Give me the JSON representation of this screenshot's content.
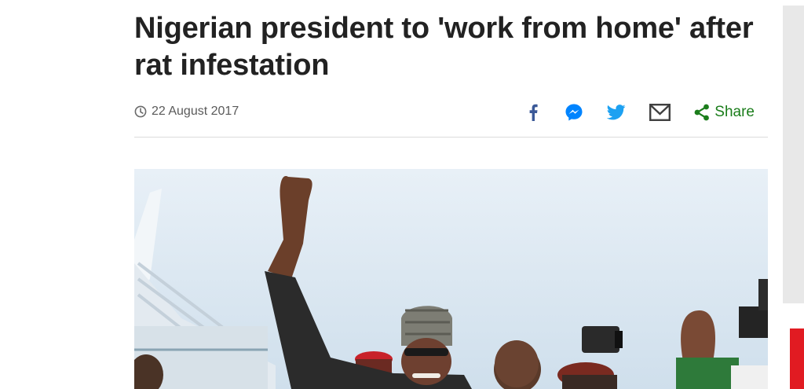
{
  "article": {
    "headline": "Nigerian president to 'work from home' after rat infestation",
    "date": "22 August 2017"
  },
  "share": {
    "label": "Share",
    "icons": [
      "facebook-icon",
      "messenger-icon",
      "twitter-icon",
      "email-icon",
      "share-icon"
    ]
  },
  "colors": {
    "text": "#222222",
    "muted": "#5a5a5a",
    "facebook": "#3b5998",
    "messenger": "#0084ff",
    "twitter": "#1da1f2",
    "email": "#404040",
    "share": "#1b7d1b",
    "accent_red": "#e11b22"
  }
}
